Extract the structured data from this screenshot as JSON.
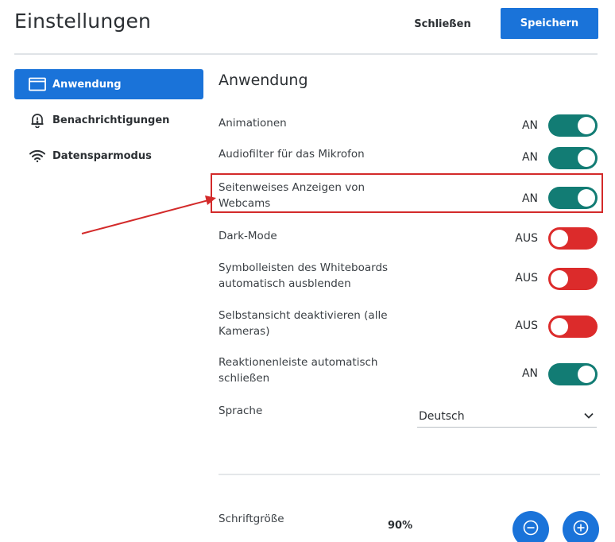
{
  "header": {
    "title": "Einstellungen",
    "close_label": "Schließen",
    "save_label": "Speichern"
  },
  "sidebar": {
    "items": [
      {
        "label": "Anwendung",
        "icon": "application-window-icon",
        "active": true
      },
      {
        "label": "Benachrichtigungen",
        "icon": "bell-alert-icon",
        "active": false
      },
      {
        "label": "Datensparmodus",
        "icon": "wifi-icon",
        "active": false
      }
    ]
  },
  "main": {
    "section_title": "Anwendung",
    "settings": [
      {
        "label": "Animationen",
        "state": "AN",
        "on": true
      },
      {
        "label": "Audiofilter für das Mikrofon",
        "state": "AN",
        "on": true
      },
      {
        "label": "Seitenweises Anzeigen von Webcams",
        "state": "AN",
        "on": true,
        "highlighted": true
      },
      {
        "label": "Dark-Mode",
        "state": "AUS",
        "on": false
      },
      {
        "label": "Symbolleisten des Whiteboards automatisch ausblenden",
        "state": "AUS",
        "on": false
      },
      {
        "label": "Selbstansicht deaktivieren (alle Kameras)",
        "state": "AUS",
        "on": false
      },
      {
        "label": "Reaktionenleiste automatisch schließen",
        "state": "AN",
        "on": true
      }
    ],
    "language": {
      "label": "Sprache",
      "value": "Deutsch"
    },
    "font_size": {
      "label": "Schriftgröße",
      "value": "90%"
    }
  },
  "colors": {
    "accent": "#1a73d9",
    "toggle_on": "#127c74",
    "toggle_off": "#dc2b2b",
    "annotation": "#d32a2a"
  }
}
